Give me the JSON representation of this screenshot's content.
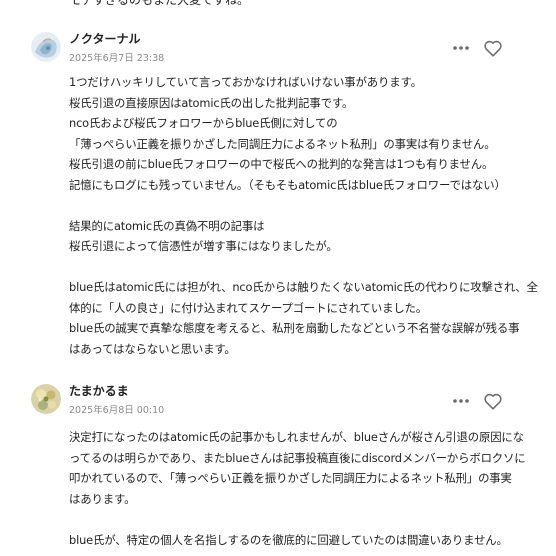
{
  "top_cut_text": "モテすぎるのもまた大変ですね。",
  "comments": [
    {
      "author": "ノクターナル",
      "date": "2025年6月7日 23:38",
      "avatar_icon": "watercolor-avatar-icon",
      "lines": [
        "1つだけハッキリしていて言っておかなければいけない事があります。",
        "桜氏引退の直接原因はatomic氏の出した批判記事です。",
        "nco氏および桜氏フォロワーからblue氏側に対しての",
        "「薄っぺらい正義を振りかざした同調圧力によるネット私刑」の事実は有りません。",
        "桜氏引退の前にblue氏フォロワーの中で桜氏への批判的な発言は1つも有りません。",
        "記憶にもログにも残っていません。（そもそもatomic氏はblue氏フォロワーではない）",
        "",
        "結果的にatomic氏の真偽不明の記事は",
        "桜氏引退によって信憑性が増す事にはなりましたが。",
        "",
        "blue氏はatomic氏には担がれ、nco氏からは触りたくないatomic氏の代わりに攻撃され、全",
        "体的に「人の良さ」に付け込まれてスケープゴートにされていました。",
        "blue氏の誠実で真摯な態度を考えると、私刑を扇動したなどという不名誉な誤解が残る事",
        "はあってはならないと思います。"
      ]
    },
    {
      "author": "たまかるま",
      "date": "2025年6月8日 00:10",
      "avatar_icon": "floral-avatar-icon",
      "lines": [
        "決定打になったのはatomic氏の記事かもしれませんが、blueさんが桜さん引退の原因にな",
        "ってるのは明らかであり、またblueさんは記事投稿直後にdiscordメンバーからボロクソに",
        "叩かれているので、「薄っぺらい正義を振りかざした同調圧力によるネット私刑」の事実",
        "はあります。",
        "",
        "blue氏が、特定の個人を名指しするのを徹底的に回避していたのは間違いありません。"
      ]
    }
  ],
  "colors": {
    "text": "#222222",
    "muted": "#8a8a8a",
    "icon": "#6b6b6b"
  }
}
